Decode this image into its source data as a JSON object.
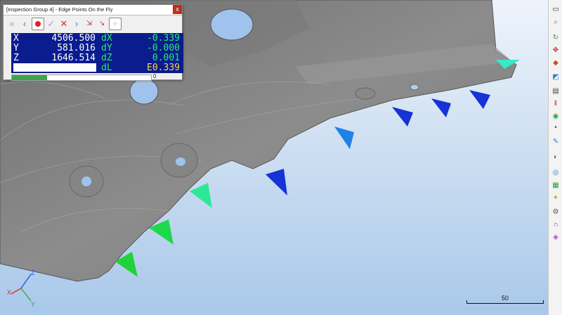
{
  "window_title": "[Inspection Group 4] - Edge Points On the Fly",
  "close_glyph": "x",
  "toolbar_icons": [
    "double-chevron-left-icon",
    "chevron-left-icon",
    "record-icon",
    "check-icon",
    "cancel-x-icon",
    "chevron-right-icon",
    "probe-icon",
    "probe-arrow-icon",
    "grid-points-icon"
  ],
  "readout": {
    "x_label": "X",
    "x_value": "4506.500",
    "y_label": "Y",
    "y_value": "581.016",
    "z_label": "Z",
    "z_value": "1646.514",
    "dx_label": "dX",
    "dx_value": "-0.339",
    "dy_label": "dY",
    "dy_value": "-0.000",
    "dz_label": "dZ",
    "dz_value": "0.001",
    "dl_label": "dL",
    "dl_value": "E0.339"
  },
  "progress": {
    "fraction": 0.25,
    "value_text": "0"
  },
  "triad": {
    "z": "Z",
    "y": "Y",
    "x": "X"
  },
  "scale_label": "50",
  "colors": {
    "panel": "#0a1c8e",
    "good": "#22ee66",
    "error": "#ffd83a"
  },
  "right_toolbar_icons": [
    "window-icon",
    "zoom-icon",
    "rotate-icon",
    "pan-icon",
    "fit-view-icon",
    "render-icon",
    "section-icon",
    "pause-icon",
    "probe-status-icon",
    "point-icon",
    "brush-icon",
    "hide-icon",
    "visibility-icon",
    "layers-icon",
    "light-icon",
    "settings-icon",
    "magnet-icon",
    "tag-icon"
  ]
}
